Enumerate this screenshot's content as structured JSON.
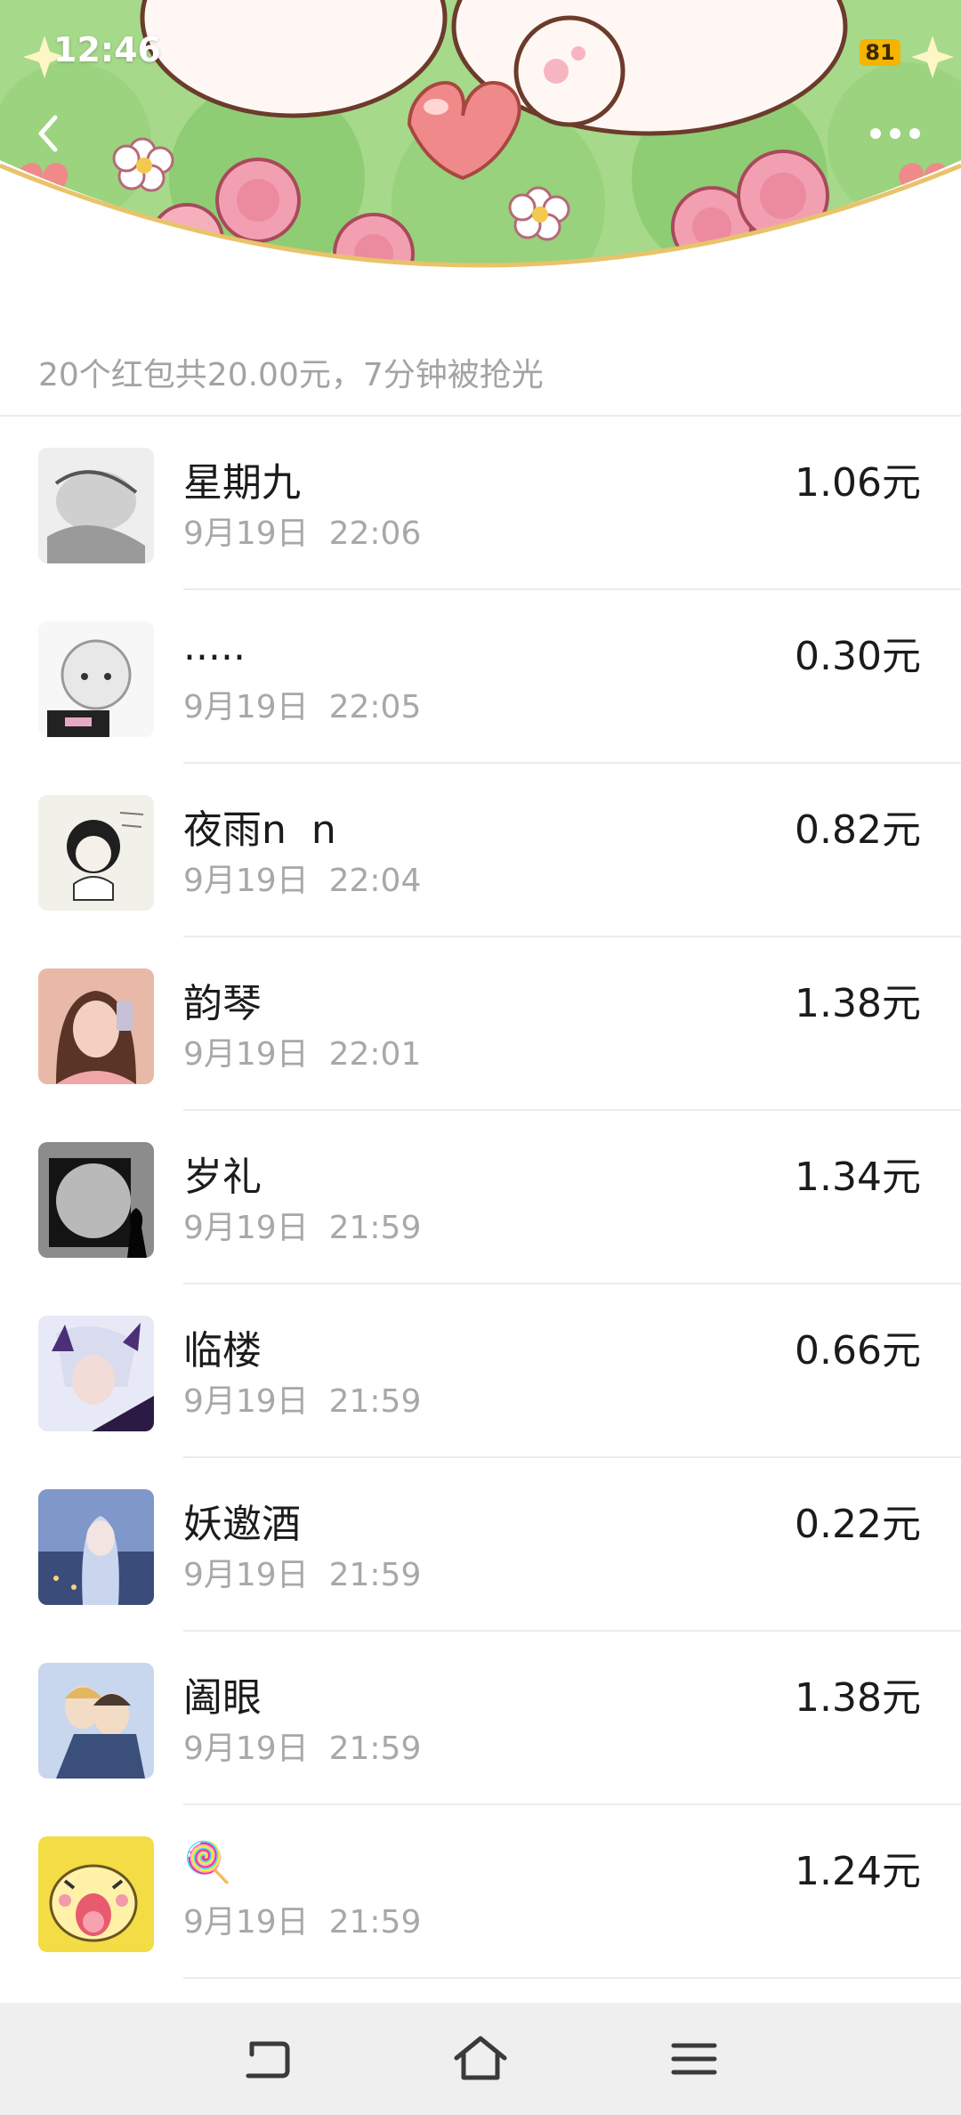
{
  "status_bar": {
    "time": "12:46",
    "battery": "81"
  },
  "header": {
    "back_icon": "chevron-left-icon",
    "more_icon": "more-dots-icon"
  },
  "summary": "20个红包共20.00元，7分钟被抢光",
  "recipients": [
    {
      "name": "星期九",
      "time": "9月19日  22:06",
      "amount": "1.06元"
    },
    {
      "name": ".....",
      "time": "9月19日  22:05",
      "amount": "0.30元"
    },
    {
      "name": "夜雨n  n",
      "time": "9月19日  22:04",
      "amount": "0.82元"
    },
    {
      "name": "韵琴",
      "time": "9月19日  22:01",
      "amount": "1.38元"
    },
    {
      "name": "岁礼",
      "time": "9月19日  21:59",
      "amount": "1.34元"
    },
    {
      "name": "临楼",
      "time": "9月19日  21:59",
      "amount": "0.66元"
    },
    {
      "name": "妖邀酒",
      "time": "9月19日  21:59",
      "amount": "0.22元"
    },
    {
      "name": "阖眼",
      "time": "9月19日  21:59",
      "amount": "1.38元"
    },
    {
      "name": "🍭",
      "time": "9月19日  21:59",
      "amount": "1.24元"
    }
  ],
  "nav": {
    "back_icon": "return-icon",
    "home_icon": "home-icon",
    "menu_icon": "menu-icon"
  },
  "colors": {
    "banner_green": "#a6d98a",
    "rose": "#f2a0b1",
    "heart": "#f08a8a",
    "gold_border": "#e8c36a"
  }
}
